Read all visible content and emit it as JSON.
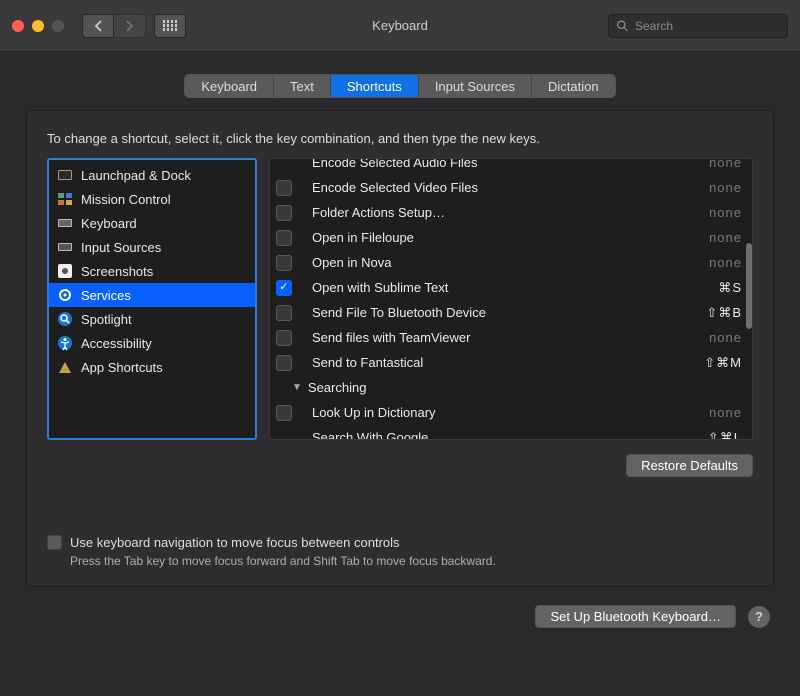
{
  "window": {
    "title": "Keyboard"
  },
  "search": {
    "placeholder": "Search"
  },
  "tabs": [
    {
      "label": "Keyboard"
    },
    {
      "label": "Text"
    },
    {
      "label": "Shortcuts",
      "active": true
    },
    {
      "label": "Input Sources"
    },
    {
      "label": "Dictation"
    }
  ],
  "instruction": "To change a shortcut, select it, click the key combination, and then type the new keys.",
  "sidebar": [
    {
      "label": "Launchpad & Dock",
      "icon": "launchpad"
    },
    {
      "label": "Mission Control",
      "icon": "mission"
    },
    {
      "label": "Keyboard",
      "icon": "keyboard"
    },
    {
      "label": "Input Sources",
      "icon": "input"
    },
    {
      "label": "Screenshots",
      "icon": "screenshot"
    },
    {
      "label": "Services",
      "icon": "gear",
      "selected": true
    },
    {
      "label": "Spotlight",
      "icon": "spotlight"
    },
    {
      "label": "Accessibility",
      "icon": "accessibility"
    },
    {
      "label": "App Shortcuts",
      "icon": "app"
    }
  ],
  "services": [
    {
      "label": "Encode Selected Audio Files",
      "checked": false,
      "shortcut": "none",
      "clipped_top": true
    },
    {
      "label": "Encode Selected Video Files",
      "checked": false,
      "shortcut": "none"
    },
    {
      "label": "Folder Actions Setup…",
      "checked": false,
      "shortcut": "none"
    },
    {
      "label": "Open in Fileloupe",
      "checked": false,
      "shortcut": "none"
    },
    {
      "label": "Open in Nova",
      "checked": false,
      "shortcut": "none"
    },
    {
      "label": "Open with Sublime Text",
      "checked": true,
      "shortcut": "⌘S"
    },
    {
      "label": "Send File To Bluetooth Device",
      "checked": false,
      "shortcut": "⇧⌘B"
    },
    {
      "label": "Send files with TeamViewer",
      "checked": false,
      "shortcut": "none"
    },
    {
      "label": "Send to Fantastical",
      "checked": false,
      "shortcut": "⇧⌘M"
    }
  ],
  "group": {
    "label": "Searching"
  },
  "services2": [
    {
      "label": "Look Up in Dictionary",
      "checked": false,
      "shortcut": "none"
    },
    {
      "label": "Search With Google",
      "checked": false,
      "shortcut": "⇧⌘L",
      "clipped_bottom": true
    }
  ],
  "restore": "Restore Defaults",
  "kbnav_label": "Use keyboard navigation to move focus between controls",
  "kbnav_help": "Press the Tab key to move focus forward and Shift Tab to move focus backward.",
  "bluetooth_btn": "Set Up Bluetooth Keyboard…"
}
